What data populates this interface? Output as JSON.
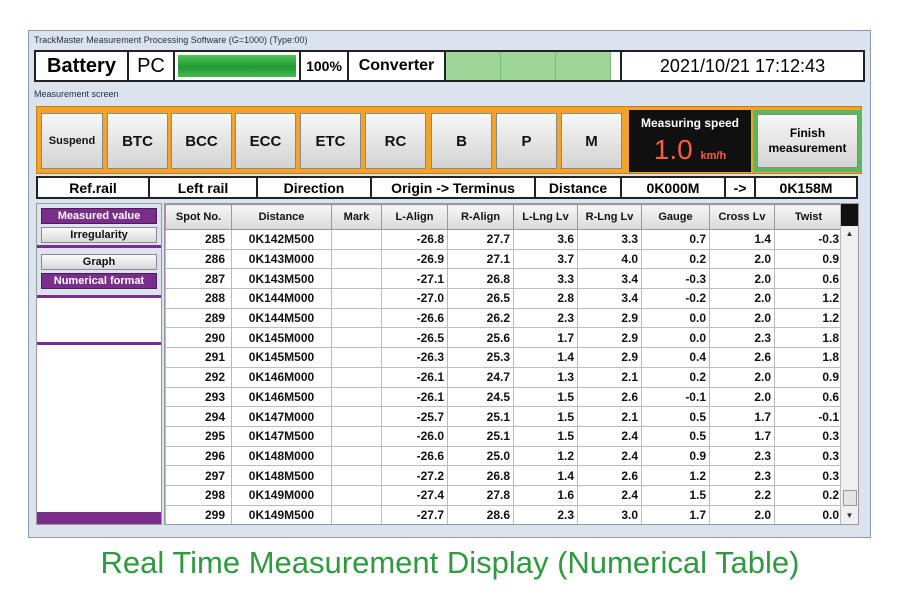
{
  "window": {
    "title": "TrackMaster Measurement Processing Software (G=1000)  (Type:00)"
  },
  "status": {
    "battery": "Battery",
    "pc": "PC",
    "pc_level_percent": 100,
    "pc_percent_label": "100%",
    "converter": "Converter",
    "datetime": "2021/10/21 17:12:43"
  },
  "section_label": "Measurement screen",
  "buttons": {
    "suspend": "Suspend",
    "btc": "BTC",
    "bcc": "BCC",
    "ecc": "ECC",
    "etc": "ETC",
    "rc": "RC",
    "b": "B",
    "p": "P",
    "m": "M",
    "finish_line1": "Finish",
    "finish_line2": "measurement"
  },
  "speed": {
    "label": "Measuring speed",
    "value": "1.0",
    "unit": "km/h"
  },
  "info": {
    "ref_rail_label": "Ref.rail",
    "ref_rail_value": "Left rail",
    "direction_label": "Direction",
    "direction_value": "Origin -> Terminus",
    "distance_label": "Distance",
    "distance_from": "0K000M",
    "arrow": "->",
    "distance_to": "0K158M"
  },
  "side": {
    "measured_value": "Measured value",
    "irregularity": "Irregularity",
    "graph": "Graph",
    "numerical_format": "Numerical format"
  },
  "table": {
    "headers": [
      "Spot No.",
      "Distance",
      "Mark",
      "L-Align",
      "R-Align",
      "L-Lng Lv",
      "R-Lng Lv",
      "Gauge",
      "Cross Lv",
      "Twist"
    ],
    "rows": [
      [
        "285",
        "0K142M500",
        "",
        "-26.8",
        "27.7",
        "3.6",
        "3.3",
        "0.7",
        "1.4",
        "-0.3"
      ],
      [
        "286",
        "0K143M000",
        "",
        "-26.9",
        "27.1",
        "3.7",
        "4.0",
        "0.2",
        "2.0",
        "0.9"
      ],
      [
        "287",
        "0K143M500",
        "",
        "-27.1",
        "26.8",
        "3.3",
        "3.4",
        "-0.3",
        "2.0",
        "0.6"
      ],
      [
        "288",
        "0K144M000",
        "",
        "-27.0",
        "26.5",
        "2.8",
        "3.4",
        "-0.2",
        "2.0",
        "1.2"
      ],
      [
        "289",
        "0K144M500",
        "",
        "-26.6",
        "26.2",
        "2.3",
        "2.9",
        "0.0",
        "2.0",
        "1.2"
      ],
      [
        "290",
        "0K145M000",
        "",
        "-26.5",
        "25.6",
        "1.7",
        "2.9",
        "0.0",
        "2.3",
        "1.8"
      ],
      [
        "291",
        "0K145M500",
        "",
        "-26.3",
        "25.3",
        "1.4",
        "2.9",
        "0.4",
        "2.6",
        "1.8"
      ],
      [
        "292",
        "0K146M000",
        "",
        "-26.1",
        "24.7",
        "1.3",
        "2.1",
        "0.2",
        "2.0",
        "0.9"
      ],
      [
        "293",
        "0K146M500",
        "",
        "-26.1",
        "24.5",
        "1.5",
        "2.6",
        "-0.1",
        "2.0",
        "0.6"
      ],
      [
        "294",
        "0K147M000",
        "",
        "-25.7",
        "25.1",
        "1.5",
        "2.1",
        "0.5",
        "1.7",
        "-0.1"
      ],
      [
        "295",
        "0K147M500",
        "",
        "-26.0",
        "25.1",
        "1.5",
        "2.4",
        "0.5",
        "1.7",
        "0.3"
      ],
      [
        "296",
        "0K148M000",
        "",
        "-26.6",
        "25.0",
        "1.2",
        "2.4",
        "0.9",
        "2.3",
        "0.3"
      ],
      [
        "297",
        "0K148M500",
        "",
        "-27.2",
        "26.8",
        "1.4",
        "2.6",
        "1.2",
        "2.3",
        "0.3"
      ],
      [
        "298",
        "0K149M000",
        "",
        "-27.4",
        "27.8",
        "1.6",
        "2.4",
        "1.5",
        "2.2",
        "0.2"
      ],
      [
        "299",
        "0K149M500",
        "",
        "-27.7",
        "28.6",
        "2.3",
        "3.0",
        "1.7",
        "2.0",
        "0.0"
      ]
    ]
  },
  "caption": "Real Time Measurement Display (Numerical Table)"
}
